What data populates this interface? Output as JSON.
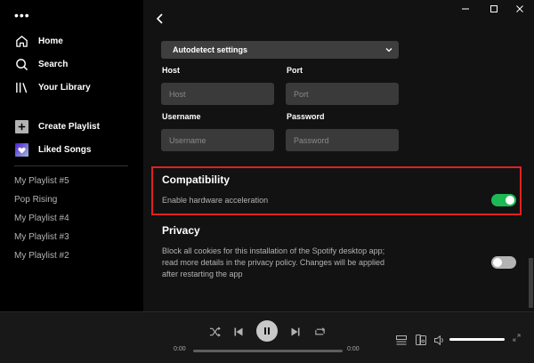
{
  "sidebar": {
    "menu_dots": "•••",
    "nav": [
      {
        "label": "Home",
        "icon": "home-icon"
      },
      {
        "label": "Search",
        "icon": "search-icon"
      },
      {
        "label": "Your Library",
        "icon": "library-icon"
      }
    ],
    "actions": [
      {
        "label": "Create Playlist",
        "icon": "plus-icon"
      },
      {
        "label": "Liked Songs",
        "icon": "heart-icon"
      }
    ],
    "playlists": [
      "My Playlist #5",
      "Pop Rising",
      "My Playlist #4",
      "My Playlist #3",
      "My Playlist #2"
    ]
  },
  "settings": {
    "proxy_type": "Autodetect settings",
    "host": {
      "label": "Host",
      "placeholder": "Host"
    },
    "port": {
      "label": "Port",
      "placeholder": "Port"
    },
    "username": {
      "label": "Username",
      "placeholder": "Username"
    },
    "password": {
      "label": "Password",
      "placeholder": "Password"
    },
    "compatibility": {
      "title": "Compatibility",
      "hardware_acceleration_label": "Enable hardware acceleration",
      "hardware_acceleration_on": true
    },
    "privacy": {
      "title": "Privacy",
      "description": "Block all cookies for this installation of the Spotify desktop app; read more details in the privacy policy. Changes will be applied after restarting the app",
      "block_cookies_on": false
    }
  },
  "player": {
    "elapsed": "0:00",
    "duration": "0:00",
    "progress": 0,
    "volume": 1.0
  },
  "colors": {
    "accent_green": "#1db954",
    "highlight_red": "#e02020",
    "main_bg": "#121212",
    "sidebar_bg": "#000000",
    "player_bg": "#181818"
  }
}
